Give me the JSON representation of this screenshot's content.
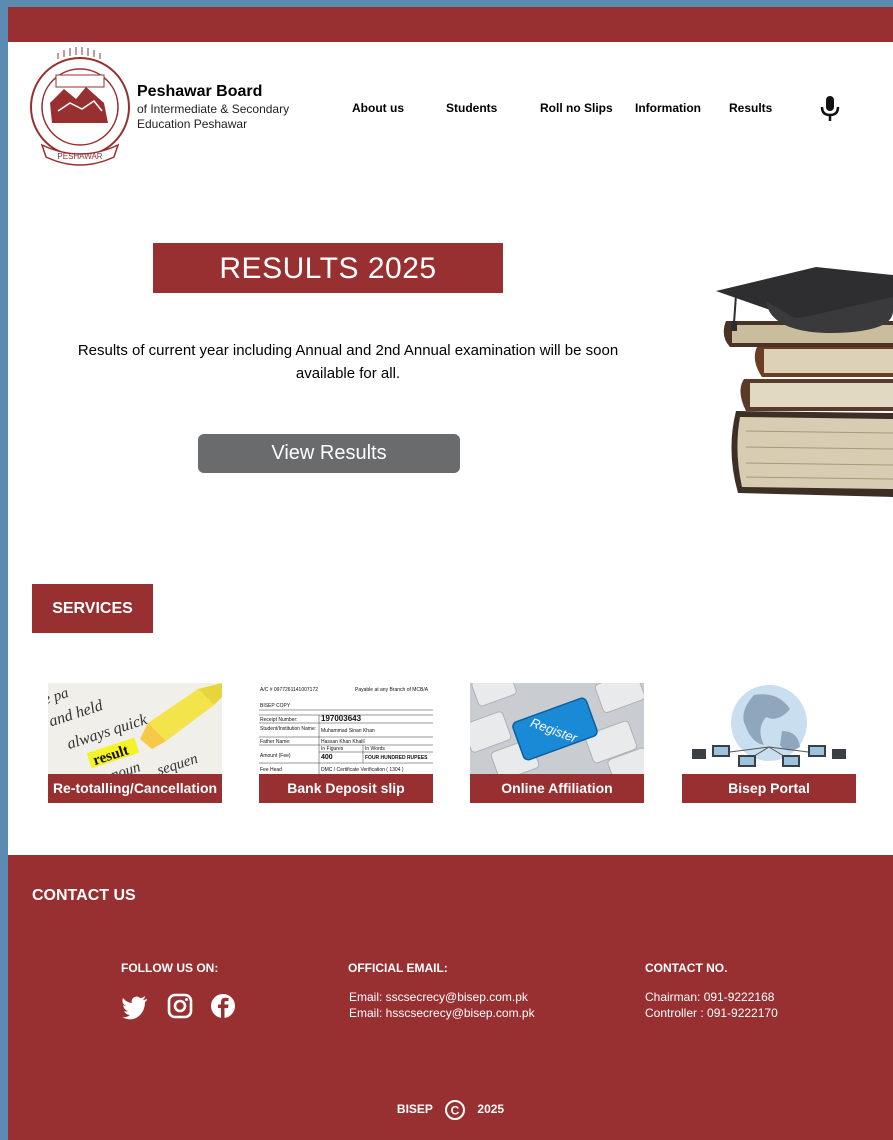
{
  "header": {
    "brand_title": "Peshawar Board",
    "brand_subtitle": "of Intermediate & Secondary Education Peshawar",
    "logo_text": "PESHAWAR",
    "nav": [
      {
        "label": "About us"
      },
      {
        "label": "Students"
      },
      {
        "label": "Roll no Slips"
      },
      {
        "label": "Information"
      },
      {
        "label": "Results"
      }
    ],
    "mic_icon": "microphone-icon"
  },
  "hero": {
    "banner": "RESULTS 2025",
    "description": "Results of current year including Annual and 2nd Annual examination will be soon available for all.",
    "button": "View Results",
    "image": "graduation-cap-books-image"
  },
  "services": {
    "title": "SERVICES",
    "cards": [
      {
        "label": "Re-totalling/Cancellation",
        "image": "highlighted-result-image"
      },
      {
        "label": "Bank Deposit slip",
        "image": "deposit-slip-image"
      },
      {
        "label": "Online Affiliation",
        "image": "register-key-image"
      },
      {
        "label": "Bisep Portal",
        "image": "globe-network-image"
      }
    ],
    "slip": {
      "account": "A/C # 0977261141007172",
      "payable": "Payable at any Branch of MCB/A",
      "copy": "BISEP COPY",
      "receipt_label": "Receipt Number:",
      "receipt_value": "197003643",
      "student_label": "Student/Institution Name:",
      "student_value": "Muhammad Sinan Khan",
      "father_label": "Father Name:",
      "father_value": "Hassan Khan Khalil",
      "amount_label": "Amount (Fee)",
      "in_figures": "In Figures",
      "in_words": "In Words",
      "amount_value": "400",
      "amount_words": "FOUR HUNDRED RUPEES",
      "fee_head_label": "Fee Head",
      "fee_head_value": "DMC / Certificate Verification ( 1304 )"
    },
    "result_words": {
      "w1": "e pa",
      "w2": "and held",
      "w3": "always quick",
      "w4": "result",
      "w5": "noun",
      "w6": "sequen"
    },
    "register_word": "Register"
  },
  "footer": {
    "title": "CONTACT US",
    "follow_title": "FOLLOW US ON:",
    "social": [
      "twitter-icon",
      "instagram-icon",
      "facebook-icon"
    ],
    "email_title": "OFFICIAL EMAIL:",
    "emails": [
      "Email: sscsecrecy@bisep.com.pk",
      "Email: hsscsecrecy@bisep.com.pk"
    ],
    "contact_title": "CONTACT NO.",
    "contacts": [
      "Chairman: 091-9222168",
      "Controller : 091-9222170"
    ],
    "copyright_left": "BISEP",
    "copyright_symbol": "C",
    "copyright_year": "2025"
  },
  "colors": {
    "brand": "#982f31",
    "button": "#6a6b6d",
    "frame": "#5b8bb0"
  }
}
